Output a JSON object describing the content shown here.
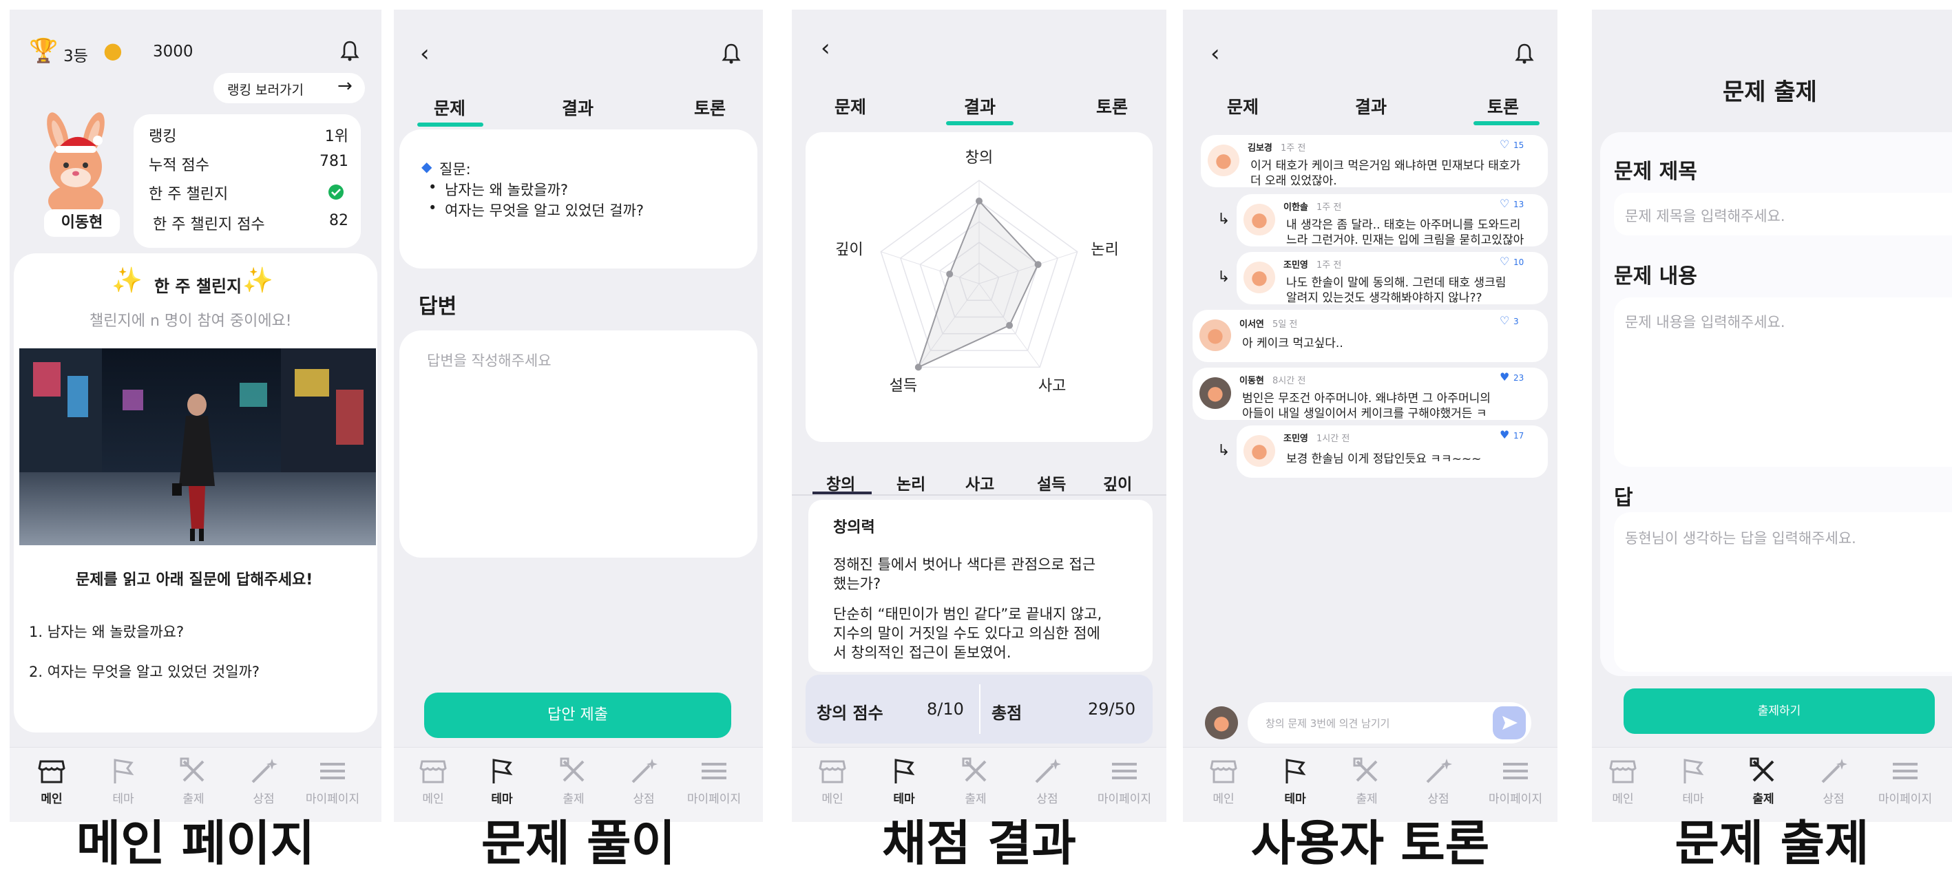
{
  "colors": {
    "accent": "#11c9a6",
    "panel_bg": "#efeff3",
    "heart_blue": "#2f73e8",
    "check_green": "#19b35a"
  },
  "nav": [
    {
      "label": "메인",
      "icon": "store-icon"
    },
    {
      "label": "테마",
      "icon": "flag-icon"
    },
    {
      "label": "출제",
      "icon": "tools-icon"
    },
    {
      "label": "상점",
      "icon": "magic-wand-icon"
    },
    {
      "label": "마이페이지",
      "icon": "menu-icon"
    }
  ],
  "captions": [
    "메인 페이지",
    "문제 풀이",
    "채점 결과",
    "사용자 토론",
    "문제 출제"
  ],
  "main": {
    "rank": "3등",
    "coins": "3000",
    "ranking_link": "랭킹 보러가기",
    "username": "이동현",
    "stats": [
      {
        "label": "랭킹",
        "value": "1위"
      },
      {
        "label": "누적 점수",
        "value": "781"
      },
      {
        "label": "한 주 챌린지",
        "value": ""
      },
      {
        "label": "한 주 챌린지 점수",
        "value": "82"
      }
    ],
    "challenge_title": "한 주 챌린지",
    "challenge_sub": "챌린지에 n 명이 참여 중이에요!",
    "instruction": "문제를 읽고 아래 질문에 답해주세요!",
    "questions": [
      "1. 남자는 왜 놀랐을까요?",
      "2. 여자는 무엇을 알고 있었던 것일까?"
    ]
  },
  "solve": {
    "tabs": [
      "문제",
      "결과",
      "토론"
    ],
    "question_label": "질문:",
    "bullets": [
      "남자는 왜 놀랐을까?",
      "여자는 무엇을 알고 있었던 걸까?"
    ],
    "answer_title": "답변",
    "answer_placeholder": "답변을 작성해주세요",
    "submit": "답안 제출"
  },
  "result": {
    "tabs": [
      "문제",
      "결과",
      "토론"
    ],
    "chart_data": {
      "type": "radar",
      "axes": [
        "창의",
        "논리",
        "사고",
        "설득",
        "깊이"
      ],
      "values": [
        8,
        6,
        5,
        10,
        3
      ],
      "max": 10
    },
    "criteria_tabs": [
      "창의",
      "논리",
      "사고",
      "설득",
      "깊이"
    ],
    "detail_title": "창의력",
    "detail_p1a": "정해진 틀에서 벗어나 색다른 관점으로 접근",
    "detail_p1b": "했는가?",
    "detail_p2a": "단순히 “태민이가 범인 같다”로 끝내지 않고,",
    "detail_p2b": "지수의 말이 거짓일 수도 있다고 의심한 점에",
    "detail_p2c": "서 창의적인 접근이 돋보였어.",
    "score_label": "창의 점수",
    "score_value": "8/10",
    "total_label": "총점",
    "total_value": "29/50"
  },
  "discussion": {
    "tabs": [
      "문제",
      "결과",
      "토론"
    ],
    "comments": [
      {
        "name": "김보경",
        "time": "1주 전",
        "likes": "15",
        "liked": false,
        "reply": false,
        "text1": "이거 태호가 케이크 먹은거임 왜냐하면 민재보다 태호가",
        "text2": "더 오래 있었잖아."
      },
      {
        "name": "이한솔",
        "time": "1주 전",
        "likes": "13",
        "liked": false,
        "reply": true,
        "text1": "내 생각은 좀 달라.. 태호는 아주머니를 도와드리",
        "text2": "느라 그런거야. 민재는 입에 크림을 묻히고있잖아"
      },
      {
        "name": "조민영",
        "time": "1주 전",
        "likes": "10",
        "liked": false,
        "reply": true,
        "text1": "나도 한솔이 말에 동의해. 그런데 태호 생크림",
        "text2": "알려지 있는것도 생각해봐야하지 않나??"
      },
      {
        "name": "이서연",
        "time": "5일 전",
        "likes": "3",
        "liked": false,
        "reply": false,
        "text1": "아 케이크 먹고싶다..",
        "text2": ""
      },
      {
        "name": "이동현",
        "time": "8시간 전",
        "likes": "23",
        "liked": true,
        "reply": false,
        "text1": "범인은 무조건 아주머니야. 왜냐하면 그 아주머니의",
        "text2": "아들이 내일 생일이어서 케이크를 구해야했거든 ㅋ"
      },
      {
        "name": "조민영",
        "time": "1시간 전",
        "likes": "17",
        "liked": true,
        "reply": true,
        "text1": "보경 한솔님 이게 정답인듯요 ㅋㅋ~~~",
        "text2": ""
      }
    ],
    "input_placeholder": "창의 문제 3번에 의견 남기기"
  },
  "create": {
    "title": "문제 출제",
    "field1_label": "문제 제목",
    "field1_placeholder": "문제 제목을 입력해주세요.",
    "field2_label": "문제 내용",
    "field2_placeholder": "문제 내용을 입력해주세요.",
    "field3_label": "답",
    "field3_placeholder": "동현님이 생각하는 답을 입력해주세요.",
    "submit": "출제하기"
  }
}
